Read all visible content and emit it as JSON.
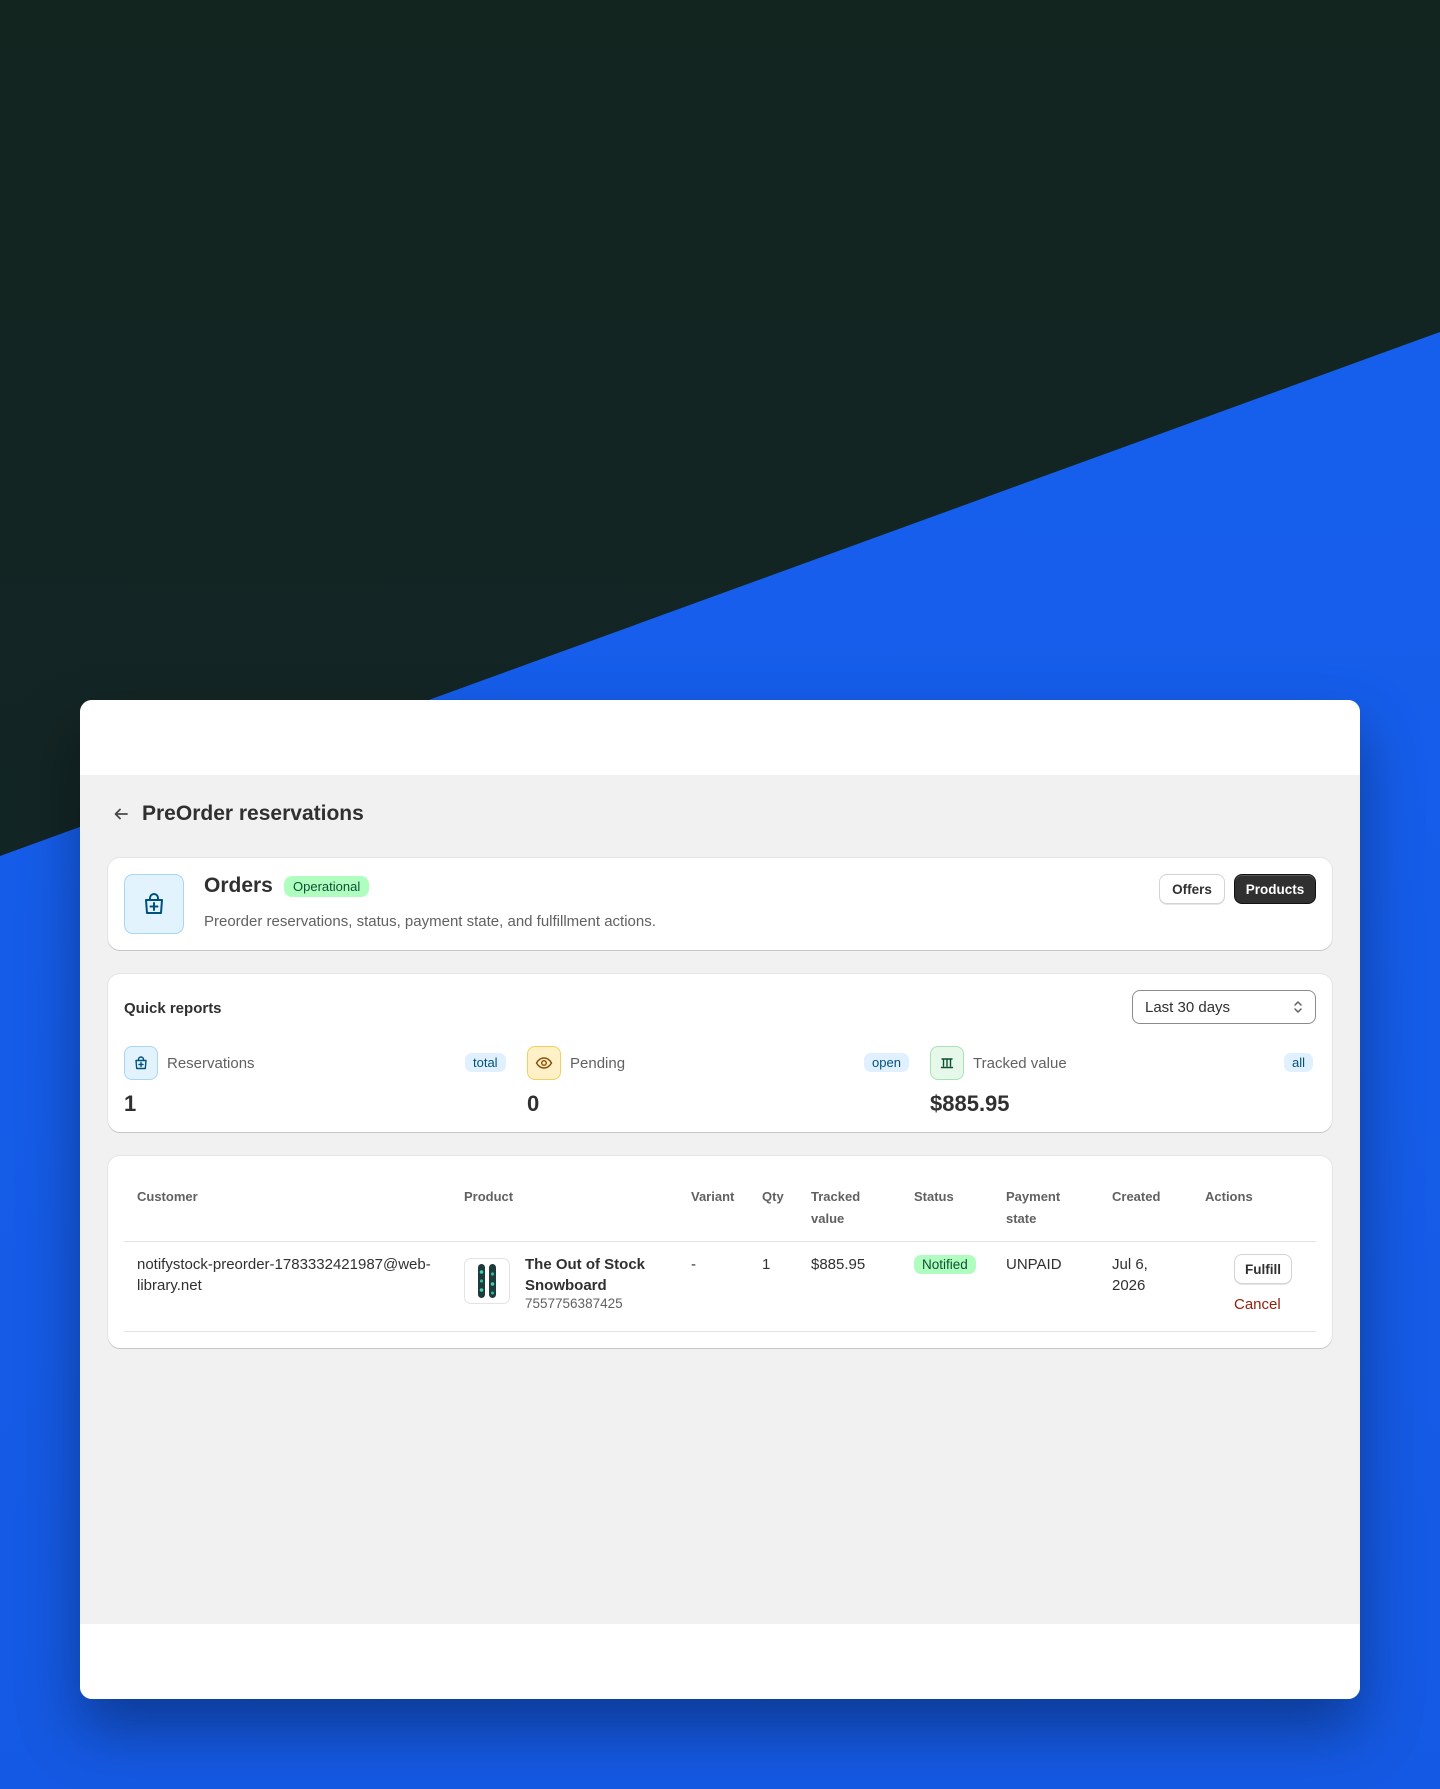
{
  "page": {
    "title": "PreOrder reservations"
  },
  "orders_card": {
    "title": "Orders",
    "status_badge": "Operational",
    "description": "Preorder reservations, status, payment state, and fulfillment actions.",
    "offers_button": "Offers",
    "products_button": "Products",
    "icon": "shopping-bag-icon"
  },
  "quick_reports": {
    "title": "Quick reports",
    "range_select": {
      "value": "Last 30 days"
    },
    "metrics": [
      {
        "label": "Reservations",
        "tag": "total",
        "value": "1",
        "icon": "bag-icon",
        "icon_bg": "#e3f3fe",
        "icon_border": "#a8d6f5"
      },
      {
        "label": "Pending",
        "tag": "open",
        "value": "0",
        "icon": "eye-icon",
        "icon_bg": "#fff1c7",
        "icon_border": "#f3cf62"
      },
      {
        "label": "Tracked value",
        "tag": "all",
        "value": "$885.95",
        "icon": "bank-icon",
        "icon_bg": "#e6f8ea",
        "icon_border": "#a6e3b4"
      }
    ]
  },
  "table": {
    "headers": {
      "customer": "Customer",
      "product": "Product",
      "variant": "Variant",
      "qty": "Qty",
      "tracked_value_1": "Tracked",
      "tracked_value_2": "value",
      "status": "Status",
      "payment_state_1": "Payment",
      "payment_state_2": "state",
      "created": "Created",
      "actions": "Actions"
    },
    "rows": [
      {
        "customer_1": "notifystock-preorder-1783332421987@web-",
        "customer_2": "library.net",
        "product_name_1": "The Out of Stock",
        "product_name_2": "Snowboard",
        "product_id": "7557756387425",
        "variant": "-",
        "qty": "1",
        "tracked_value": "$885.95",
        "status": "Notified",
        "payment_state": "UNPAID",
        "created_1": "Jul 6,",
        "created_2": "2026",
        "fulfill_label": "Fulfill",
        "cancel_label": "Cancel"
      }
    ]
  }
}
